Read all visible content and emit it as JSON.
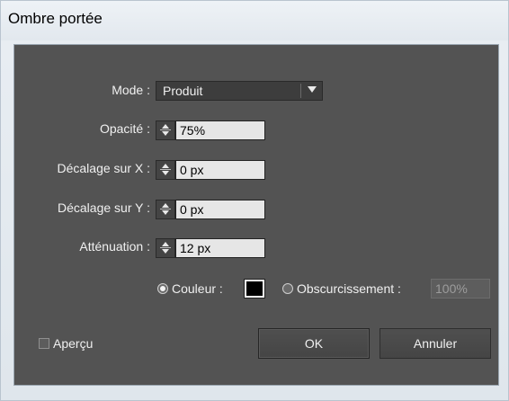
{
  "window": {
    "title": "Ombre portée"
  },
  "form": {
    "mode": {
      "label": "Mode :",
      "value": "Produit"
    },
    "opacity": {
      "label": "Opacité :",
      "value": "75%"
    },
    "offset_x": {
      "label": "Décalage sur X :",
      "value": "0 px"
    },
    "offset_y": {
      "label": "Décalage sur Y :",
      "value": "0 px"
    },
    "blur": {
      "label": "Atténuation :",
      "value": "12 px"
    },
    "color_option": {
      "label": "Couleur :",
      "selected": true,
      "swatch_color": "#000000"
    },
    "darkness_option": {
      "label": "Obscurcissement :",
      "selected": false,
      "value": "100%"
    }
  },
  "preview": {
    "label": "Aperçu",
    "checked": false
  },
  "buttons": {
    "ok": "OK",
    "cancel": "Annuler"
  },
  "colors": {
    "panel_bg": "#535353",
    "field_bg": "#e6e6e6"
  }
}
